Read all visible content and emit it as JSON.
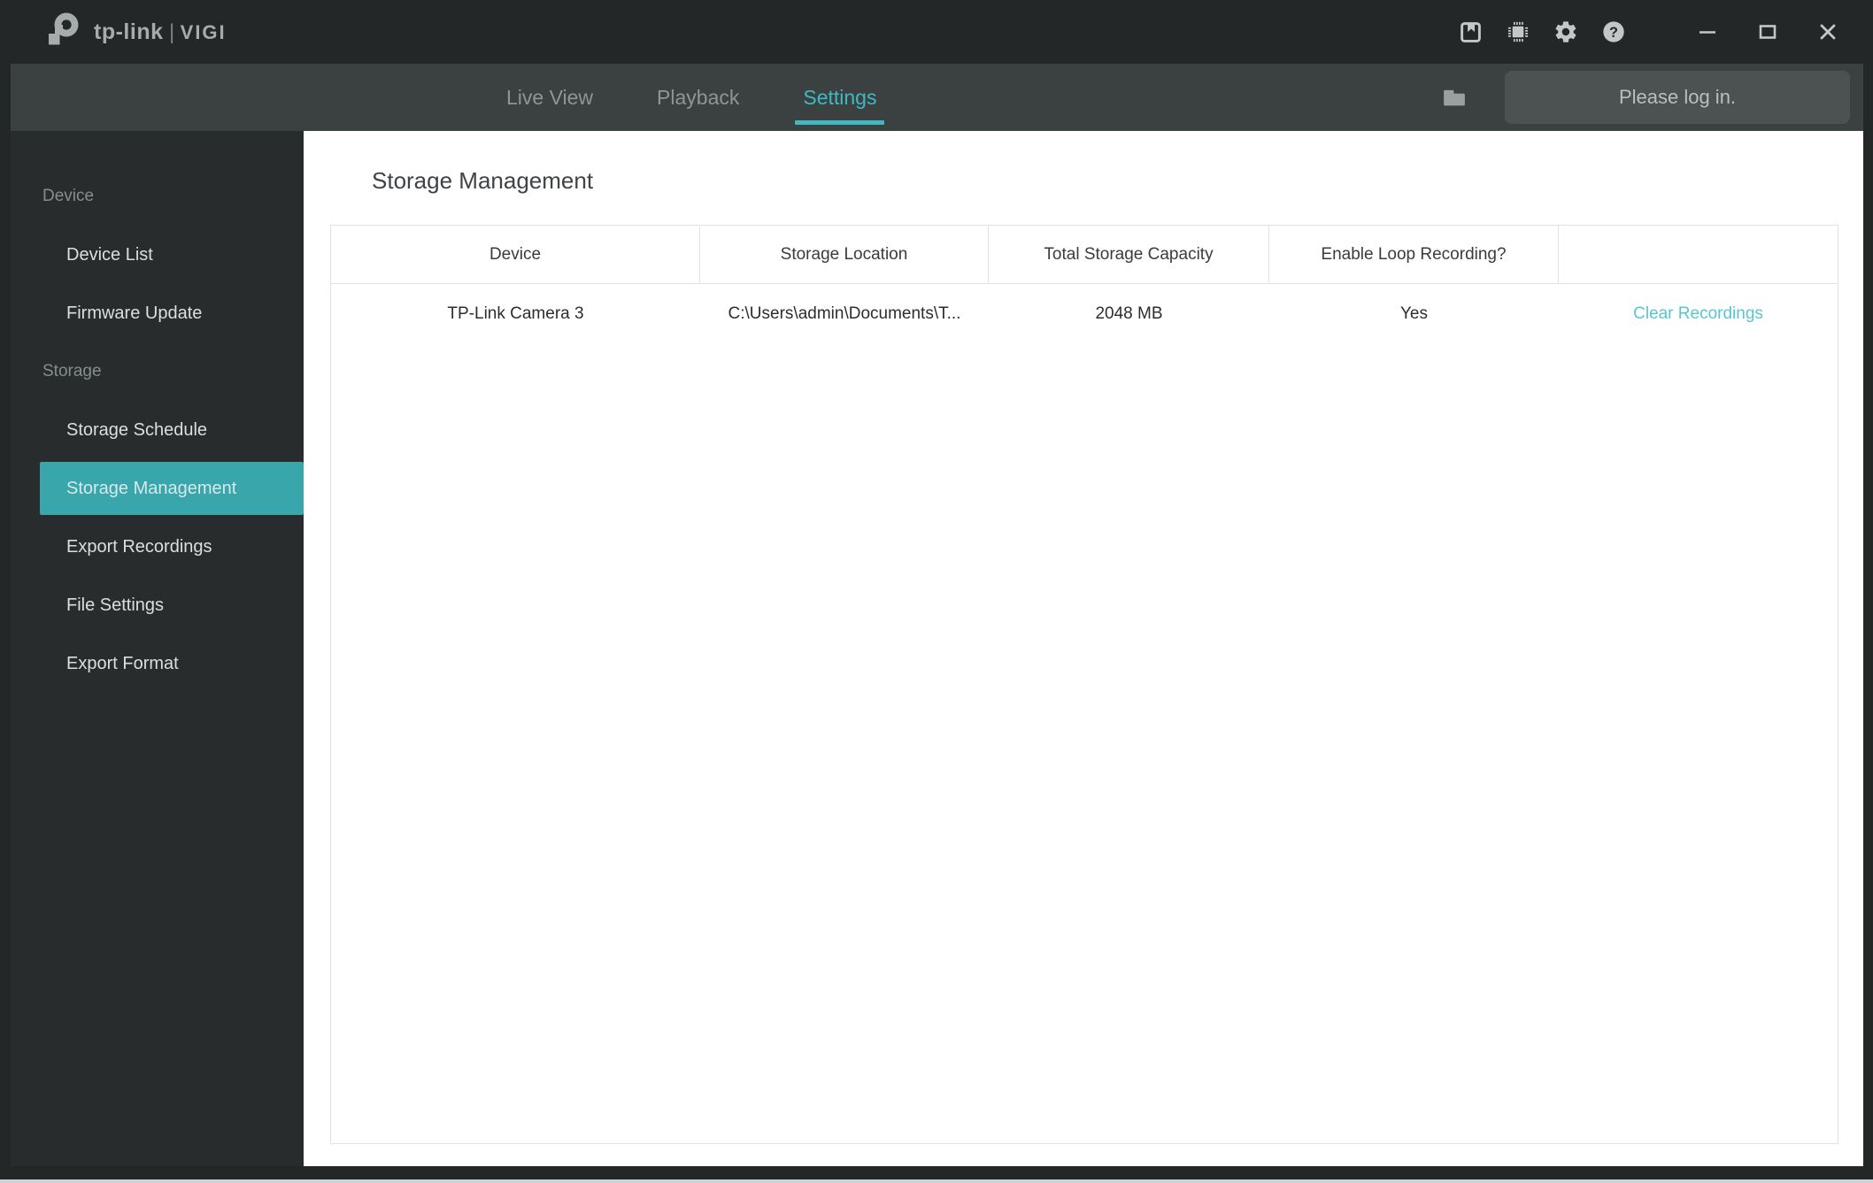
{
  "colors": {
    "accent": "#38a6ab",
    "accent-bright": "#41b9c2",
    "link": "#58c5d2"
  },
  "titlebar": {
    "brand": {
      "name": "tp-link",
      "separator": "|",
      "product": "VIGI"
    },
    "icons": [
      "save-icon",
      "chip-icon",
      "gear-icon",
      "help-icon"
    ],
    "window_controls": [
      "minimize",
      "maximize",
      "close"
    ]
  },
  "navbar": {
    "tabs": [
      {
        "id": "live-view",
        "label": "Live View",
        "active": false
      },
      {
        "id": "playback",
        "label": "Playback",
        "active": false
      },
      {
        "id": "settings",
        "label": "Settings",
        "active": true
      }
    ],
    "folder_icon": "folder-icon",
    "login_button": "Please log in."
  },
  "sidebar": {
    "sections": [
      {
        "label": "Device",
        "items": [
          {
            "label": "Device List",
            "active": false
          },
          {
            "label": "Firmware Update",
            "active": false
          }
        ]
      },
      {
        "label": "Storage",
        "items": [
          {
            "label": "Storage Schedule",
            "active": false
          },
          {
            "label": "Storage Management",
            "active": true
          },
          {
            "label": "Export Recordings",
            "active": false
          },
          {
            "label": "File Settings",
            "active": false
          },
          {
            "label": "Export Format",
            "active": false
          }
        ]
      }
    ]
  },
  "main": {
    "title": "Storage Management",
    "table": {
      "headers": [
        "Device",
        "Storage Location",
        "Total Storage Capacity",
        "Enable Loop Recording?",
        ""
      ],
      "rows": [
        {
          "cells": [
            "TP-Link Camera 3",
            "C:\\Users\\admin\\Documents\\T...",
            "2048 MB",
            "Yes"
          ],
          "action": "Clear Recordings"
        }
      ]
    }
  }
}
